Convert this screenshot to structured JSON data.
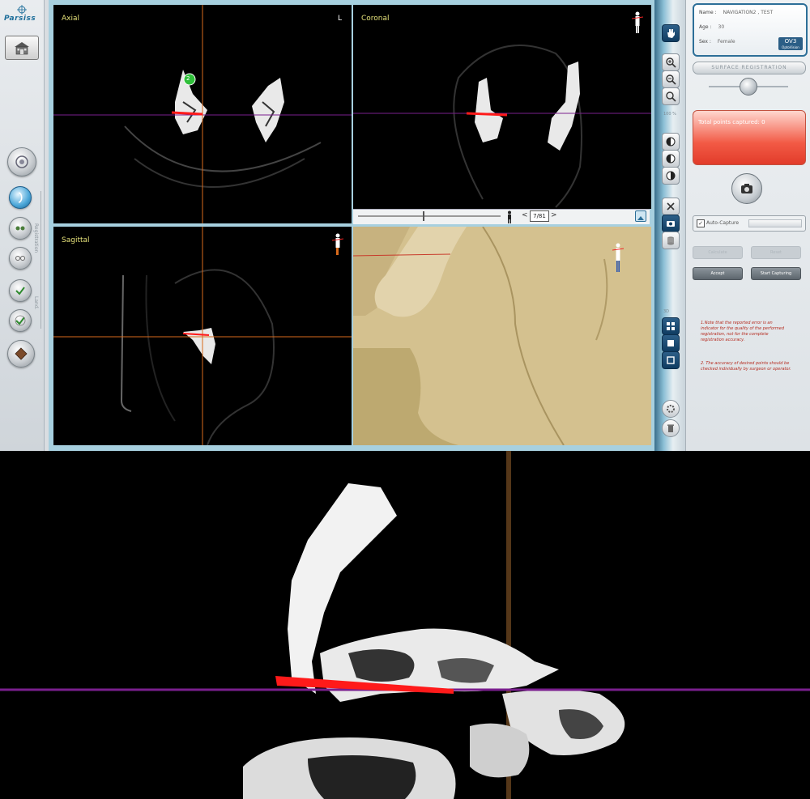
{
  "app": {
    "logo": "Parsiss"
  },
  "sidebar": {
    "rail_labels": [
      "Registration",
      "Land."
    ]
  },
  "views": {
    "axial_label": "Axial",
    "coronal_label": "Coronal",
    "sagittal_label": "Sagittal",
    "axial_marker": "2",
    "axial_corner": "L"
  },
  "navigator": {
    "slice": "7/81",
    "prev": "<",
    "next": ">"
  },
  "toolbar": {
    "zoom_label": "100 %",
    "view_label": "3D"
  },
  "patient": {
    "name_label": "Name :",
    "name_value": "NAVIGATION2 , TEST",
    "age_label": "Age :",
    "age_value": "30",
    "sex_label": "Sex :",
    "sex_value": "Female",
    "device": "OV3",
    "device_sub": "OptoVision"
  },
  "registration": {
    "title": "SURFACE REGISTRATION",
    "total_points": "Total points captured: 0",
    "auto_capture_label": "Auto-Capture",
    "auto_capture_checked": true,
    "btn_calculate": "Calculate",
    "btn_reset": "Reset",
    "btn_accept": "Accept",
    "btn_start": "Start Capturing",
    "note1": "1.Note that the reported error is an indicator for the quality of the performed registration, not for the complete registration accuracy.",
    "note2": "2. The accuracy of desired points should be checked individually by surgeon or operator."
  },
  "colors": {
    "accent_blue": "#2d6f98",
    "crosshair_purple": "#7a1f8e",
    "crosshair_orange": "#d86a1c",
    "probe_red": "#ff1a1a",
    "bone_tan": "#d8c69a",
    "label_yellow": "#e6e27a"
  }
}
